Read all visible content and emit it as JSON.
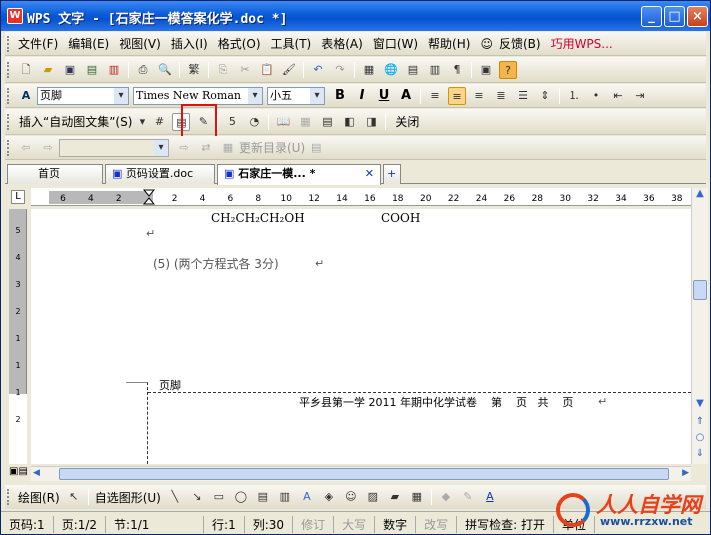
{
  "window": {
    "title": "WPS 文字 - [石家庄一模答案化学.doc *]",
    "controls": [
      "_",
      "□",
      "×"
    ]
  },
  "menu": {
    "items": [
      "文件(F)",
      "编辑(E)",
      "视图(V)",
      "插入(I)",
      "格式(O)",
      "工具(T)",
      "表格(A)",
      "窗口(W)",
      "帮助(H)"
    ],
    "feedback": "反馈(B)",
    "promo": "巧用WPS..."
  },
  "format_bar": {
    "style": "页脚",
    "font": "Times New Roman",
    "size": "小五",
    "bold": "B",
    "italic": "I",
    "underline": "U",
    "font_color": "A"
  },
  "header_footer_bar": {
    "autotext": "插入“自动图文集”(S)",
    "close": "关闭"
  },
  "nav_bar": {
    "update_toc": "更新目录(U)"
  },
  "tabs": [
    {
      "label": "首页"
    },
    {
      "label": "页码设置.doc"
    },
    {
      "label": "石家庄一模...  *"
    }
  ],
  "ruler": {
    "ticks": [
      "6",
      "4",
      "2",
      "",
      "2",
      "4",
      "6",
      "8",
      "10",
      "12",
      "14",
      "16",
      "18",
      "20",
      "22",
      "24",
      "26",
      "28",
      "30",
      "32",
      "34",
      "36",
      "38"
    ]
  },
  "vruler": {
    "ticks": [
      "5",
      "4",
      "3",
      "2",
      "1",
      "1",
      "1",
      "2"
    ]
  },
  "document": {
    "formula_left": "CH₂CH₂CH₂OH",
    "formula_right": "COOH",
    "answer_line": "(5) (两个方程式各 3分)",
    "footer_label": "页脚",
    "footer_text": "平乡县第一学 2011 年期中化学试卷    第    页   共    页"
  },
  "drawing_bar": {
    "draw": "绘图(R)",
    "autoshapes": "自选图形(U)"
  },
  "status": {
    "page": "页码:1",
    "pages": "页:1/2",
    "section": "节:1/1",
    "row": "行:1",
    "col": "列:30",
    "rev": "修订",
    "caps": "大写",
    "num": "数字",
    "ovr": "改写",
    "spell": "拼写检查: 打开",
    "unit": "单位"
  },
  "watermark": {
    "brand": "人人自学网",
    "url": "www.rrzxw.net"
  },
  "colors": {
    "titlebar": "#0553d0",
    "highlight": "#e01010",
    "watermark": "#e8401c"
  }
}
